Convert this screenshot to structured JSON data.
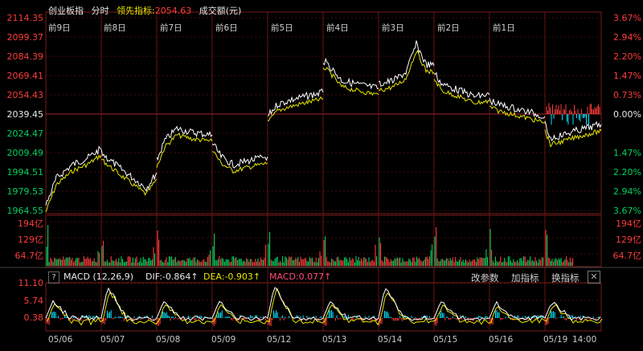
{
  "header": {
    "index_name": "创业板指",
    "chart_type": "分时",
    "leading_indicator_label": "领先指标:",
    "leading_indicator_value": "2054.63",
    "volume_label": "成交额(元)"
  },
  "price_axis": {
    "left": [
      "2114.35",
      "2099.37",
      "2084.39",
      "2069.41",
      "2054.43",
      "2039.45",
      "2024.47",
      "2009.49",
      "1994.51",
      "1979.53",
      "1964.55"
    ],
    "right": [
      "3.67%",
      "2.94%",
      "2.20%",
      "1.47%",
      "0.73%",
      "0.00%",
      "1.47%",
      "2.20%",
      "2.94%",
      "3.67%"
    ],
    "right_colors": [
      "#ff3b3b",
      "#ff3b3b",
      "#ff3b3b",
      "#ff3b3b",
      "#ff3b3b",
      "#e8e8e8",
      "#00d060",
      "#00d060",
      "#00d060",
      "#00d060"
    ]
  },
  "day_labels": [
    "前9日",
    "前8日",
    "前7日",
    "前6日",
    "前5日",
    "前4日",
    "前3日",
    "前2日",
    "前1日"
  ],
  "volume_axis": {
    "left": [
      "194亿",
      "129亿",
      "64.7亿"
    ],
    "right": [
      "194亿",
      "129亿",
      "64.7亿"
    ]
  },
  "macd": {
    "help": "?",
    "title": "MACD (12,26,9)",
    "dif": "DIF:-0.864↑",
    "dea": "DEA:-0.903↑",
    "macd": "MACD:0.077↑",
    "axis": [
      "11.10",
      "5.74",
      "0.38"
    ],
    "tools": [
      "改参数",
      "加指标",
      "换指标"
    ],
    "close": "✕"
  },
  "x_labels": [
    "05/06",
    "05/07",
    "05/08",
    "05/09",
    "05/12",
    "05/13",
    "05/14",
    "05/15",
    "05/16",
    "05/19",
    "14:00"
  ],
  "colors": {
    "up": "#ff3b3b",
    "down": "#00d060",
    "price": "#ffffff",
    "avg": "#e6e600",
    "grid": "#5a1010",
    "frame": "#7a1a1a",
    "cyan": "#00e5ff"
  }
}
